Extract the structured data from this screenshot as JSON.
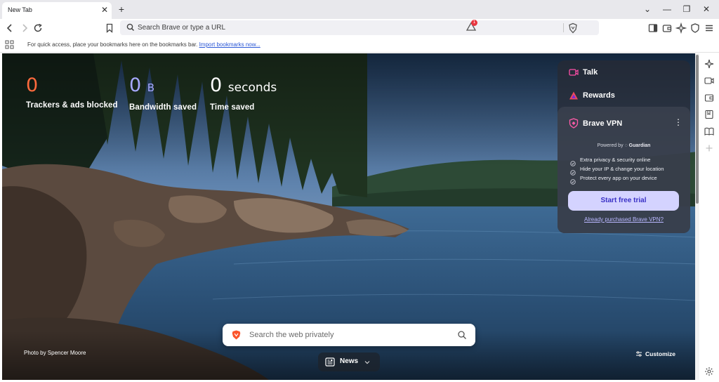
{
  "tab": {
    "title": "New Tab",
    "close_icon": "close-icon"
  },
  "toolbar": {
    "omnibox_placeholder": "Search Brave or type a URL",
    "rewards_badge": "1"
  },
  "bookmarks_bar": {
    "text": "For quick access, place your bookmarks here on the bookmarks bar.",
    "link": "Import bookmarks now..."
  },
  "stats": {
    "trackers": {
      "value": "0",
      "label": "Trackers & ads blocked"
    },
    "bandwidth": {
      "value": "0",
      "unit": "B",
      "label": "Bandwidth saved"
    },
    "time": {
      "value": "0",
      "unit": "seconds",
      "label": "Time saved"
    }
  },
  "widgets": {
    "talk": "Talk",
    "rewards": "Rewards",
    "vpn": {
      "title": "Brave VPN",
      "powered_by": "Powered by",
      "provider": "Guardian",
      "features": [
        "Extra privacy & security online",
        "Hide your IP & change your location",
        "Protect every app on your device"
      ],
      "cta": "Start free trial",
      "link": "Already purchased Brave VPN?"
    }
  },
  "search": {
    "placeholder": "Search the web privately"
  },
  "footer": {
    "photo_credit": "Photo by Spencer Moore",
    "news": "News",
    "customize": "Customize"
  },
  "colors": {
    "trackers": "#ff6a3d",
    "bandwidth": "#a7a9ff",
    "vpn_button": "#d4d3ff",
    "vpn_button_text": "#3a31c6"
  }
}
